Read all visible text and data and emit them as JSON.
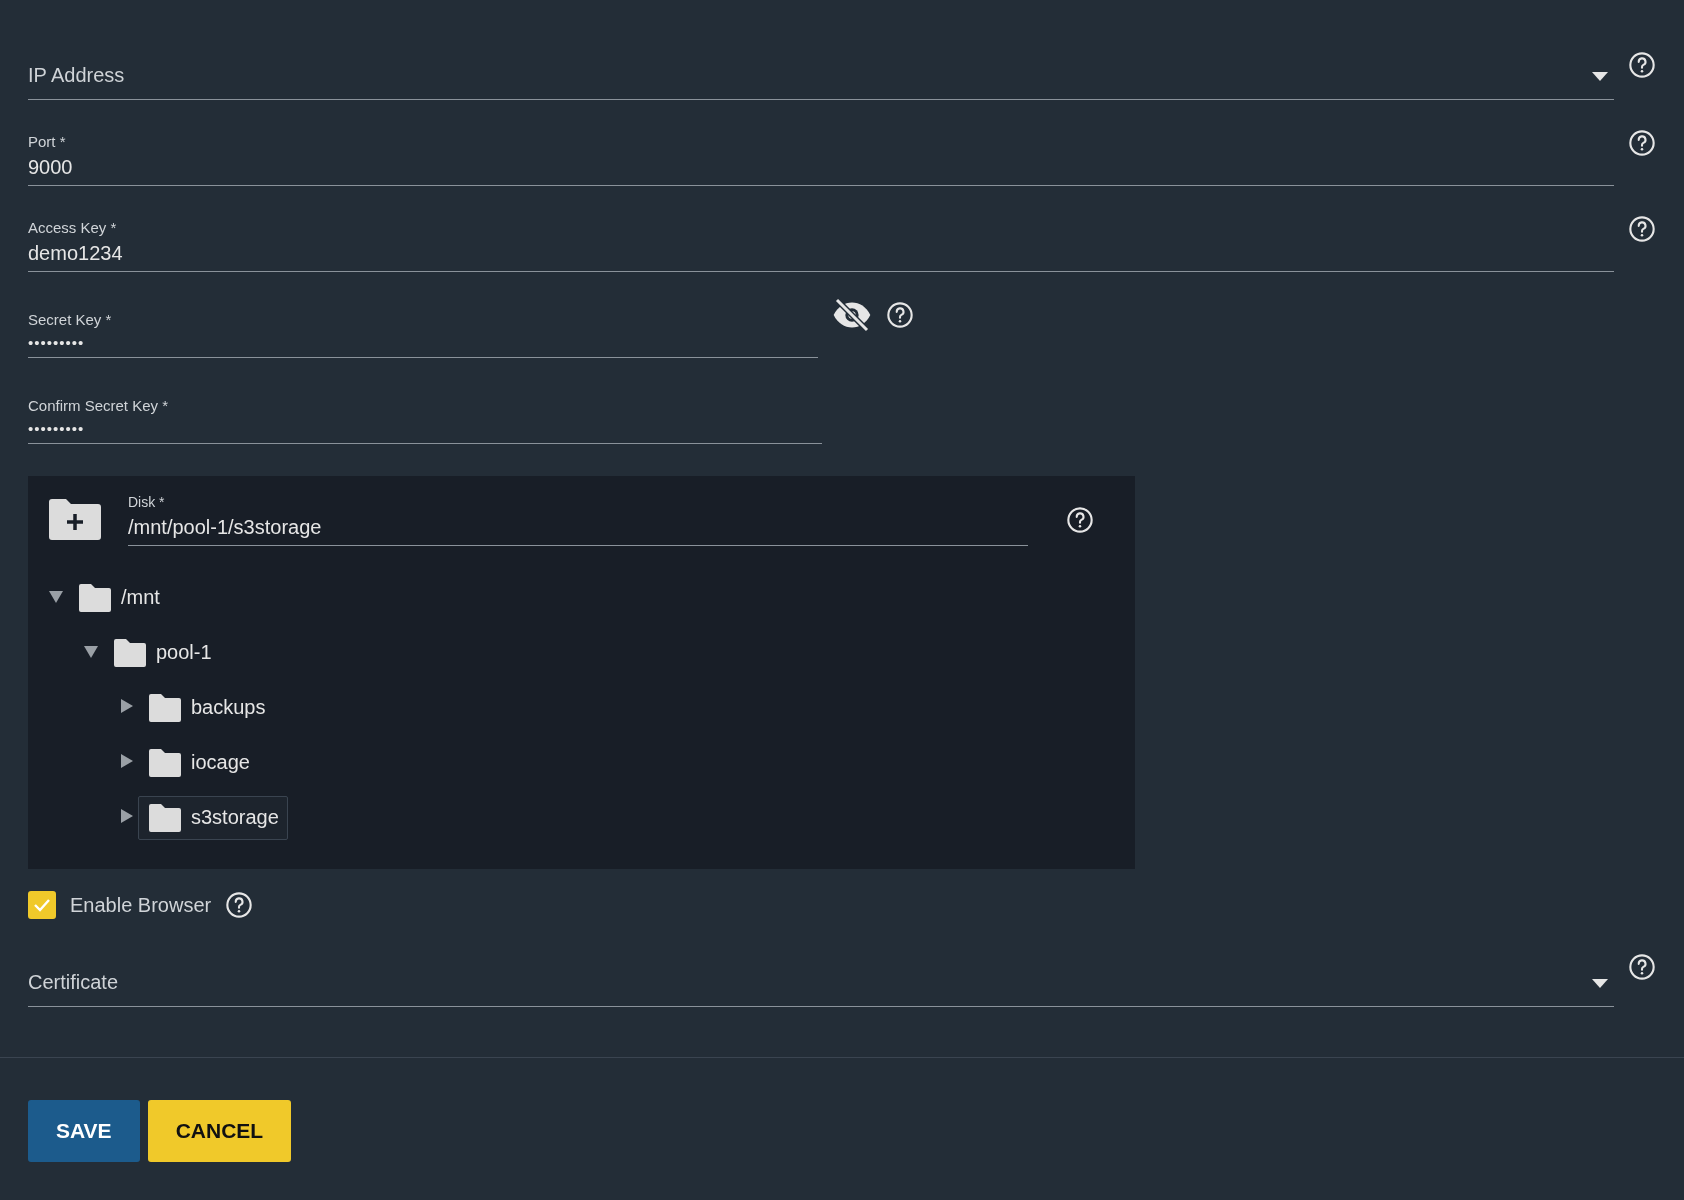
{
  "fields": [
    {
      "kind": "select",
      "placeholder": "IP Address",
      "wide": true
    },
    {
      "kind": "text",
      "label": "Port *",
      "value": "9000",
      "wide": true
    },
    {
      "kind": "text",
      "label": "Access Key *",
      "value": "demo1234",
      "wide": true
    },
    {
      "kind": "password",
      "label": "Secret Key *",
      "value": "•••••••••",
      "wide": false,
      "reveal_toggle": true
    },
    {
      "kind": "password",
      "label": "Confirm Secret Key *",
      "value": "•••••••••",
      "wide": false,
      "reveal_toggle": false
    }
  ],
  "disk": {
    "label": "Disk *",
    "value": "/mnt/pool-1/s3storage",
    "tree": [
      {
        "name": "/mnt",
        "expanded": true,
        "selected": false,
        "children": [
          {
            "name": "pool-1",
            "expanded": true,
            "selected": false,
            "children": [
              {
                "name": "backups",
                "expanded": false,
                "selected": false
              },
              {
                "name": "iocage",
                "expanded": false,
                "selected": false
              },
              {
                "name": "s3storage",
                "expanded": false,
                "selected": true
              }
            ]
          }
        ]
      }
    ]
  },
  "enable_browser": {
    "label": "Enable Browser",
    "checked": true
  },
  "certificate": {
    "placeholder": "Certificate"
  },
  "buttons": [
    {
      "label": "SAVE",
      "kind": "primary"
    },
    {
      "label": "CANCEL",
      "kind": "secondary"
    }
  ]
}
